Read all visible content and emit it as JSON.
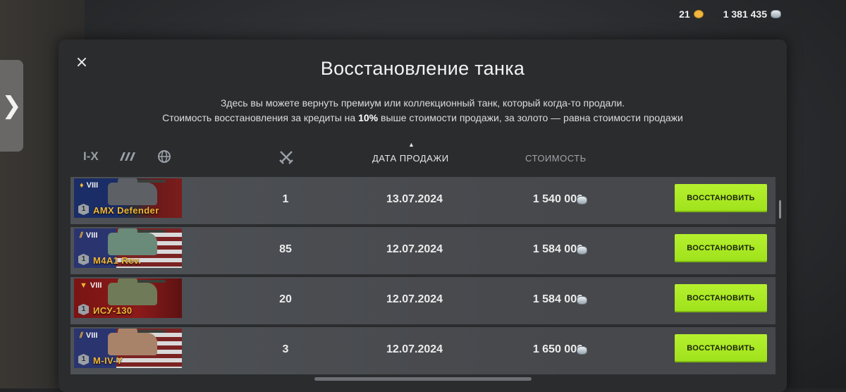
{
  "currency": {
    "gold": "21",
    "credits": "1 381 435",
    "gold_icon": "gold-coin-icon",
    "credits_icon": "silver-coins-icon"
  },
  "sidebar": {
    "toggle_glyph": "❯"
  },
  "dialog": {
    "close_glyph": "×",
    "title": "Восстановление танка",
    "desc_line1": "Здесь вы можете вернуть премиум или коллекционный танк, который когда-то продали.",
    "desc_line2_a": "Стоимость восстановления за кредиты на ",
    "desc_line2_pct": "10%",
    "desc_line2_b": " выше стоимости продажи, за золото — равна стоимости продажи"
  },
  "filters": {
    "tier": "I-X",
    "type_icon": "tank-type-filter-icon",
    "nation_icon": "globe-icon"
  },
  "columns": {
    "battles_icon": "crossed-swords-icon",
    "date": "ДАТА ПРОДАЖИ",
    "cost": "СТОИМОСТЬ",
    "sort_glyph": "▲"
  },
  "colors": {
    "accent_green": "#a8e824",
    "tank_name": "#f2b634"
  },
  "rows": [
    {
      "tier": "VIII",
      "name": "AMX Defender",
      "mastery": "1",
      "battles": "1",
      "date": "13.07.2024",
      "cost": "1 540 000",
      "button": "ВОССТАНОВИТЬ"
    },
    {
      "tier": "VIII",
      "name": "M4A1 Rev.",
      "mastery": "1",
      "battles": "85",
      "date": "12.07.2024",
      "cost": "1 584 000",
      "button": "ВОССТАНОВИТЬ"
    },
    {
      "tier": "VIII",
      "name": "ИСУ-130",
      "mastery": "1",
      "battles": "20",
      "date": "12.07.2024",
      "cost": "1 584 000",
      "button": "ВОССТАНОВИТЬ"
    },
    {
      "tier": "VIII",
      "name": "M-IV-Y",
      "mastery": "1",
      "battles": "3",
      "date": "12.07.2024",
      "cost": "1 650 000",
      "button": "ВОССТАНОВИТЬ"
    }
  ]
}
